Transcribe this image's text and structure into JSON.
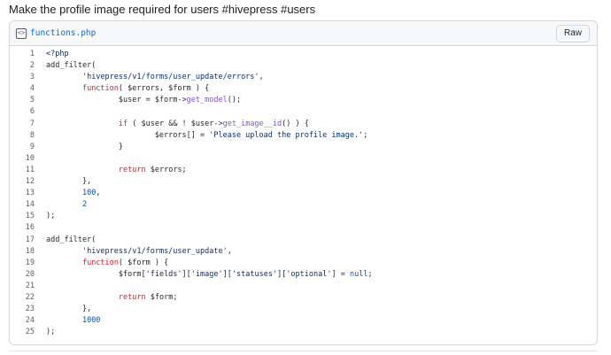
{
  "post": {
    "title": "Make the profile image required for users #hivepress #users"
  },
  "gist": {
    "file_name": "functions.php",
    "raw_label": "Raw",
    "file_icon": "code-file-icon",
    "lines": [
      {
        "n": "1",
        "tokens": [
          {
            "t": "<?php",
            "c": "s"
          }
        ]
      },
      {
        "n": "2",
        "tokens": [
          {
            "t": "add_filter(",
            "c": "v"
          }
        ]
      },
      {
        "n": "3",
        "tokens": [
          {
            "t": "        ",
            "c": "v"
          },
          {
            "t": "'hivepress/v1/forms/user_update/errors'",
            "c": "s"
          },
          {
            "t": ",",
            "c": "v"
          }
        ]
      },
      {
        "n": "4",
        "tokens": [
          {
            "t": "        ",
            "c": "v"
          },
          {
            "t": "function",
            "c": "k"
          },
          {
            "t": "( $errors, $form ) {",
            "c": "v"
          }
        ]
      },
      {
        "n": "5",
        "tokens": [
          {
            "t": "                $user = $form->",
            "c": "v"
          },
          {
            "t": "get_model",
            "c": "f"
          },
          {
            "t": "();",
            "c": "v"
          }
        ]
      },
      {
        "n": "6",
        "tokens": [
          {
            "t": "",
            "c": "v"
          }
        ]
      },
      {
        "n": "7",
        "tokens": [
          {
            "t": "                ",
            "c": "v"
          },
          {
            "t": "if",
            "c": "k"
          },
          {
            "t": " ( $user && ! $user->",
            "c": "v"
          },
          {
            "t": "get_image__id",
            "c": "f"
          },
          {
            "t": "() ) {",
            "c": "v"
          }
        ]
      },
      {
        "n": "8",
        "tokens": [
          {
            "t": "                        $errors[] = ",
            "c": "v"
          },
          {
            "t": "'Please upload the profile image.'",
            "c": "s"
          },
          {
            "t": ";",
            "c": "v"
          }
        ]
      },
      {
        "n": "9",
        "tokens": [
          {
            "t": "                }",
            "c": "v"
          }
        ]
      },
      {
        "n": "10",
        "tokens": [
          {
            "t": "",
            "c": "v"
          }
        ]
      },
      {
        "n": "11",
        "tokens": [
          {
            "t": "                ",
            "c": "v"
          },
          {
            "t": "return",
            "c": "k"
          },
          {
            "t": " $errors;",
            "c": "v"
          }
        ]
      },
      {
        "n": "12",
        "tokens": [
          {
            "t": "        },",
            "c": "v"
          }
        ]
      },
      {
        "n": "13",
        "tokens": [
          {
            "t": "        ",
            "c": "v"
          },
          {
            "t": "100",
            "c": "n"
          },
          {
            "t": ",",
            "c": "v"
          }
        ]
      },
      {
        "n": "14",
        "tokens": [
          {
            "t": "        ",
            "c": "v"
          },
          {
            "t": "2",
            "c": "n"
          }
        ]
      },
      {
        "n": "15",
        "tokens": [
          {
            "t": ");",
            "c": "v"
          }
        ]
      },
      {
        "n": "16",
        "tokens": [
          {
            "t": "",
            "c": "v"
          }
        ]
      },
      {
        "n": "17",
        "tokens": [
          {
            "t": "add_filter(",
            "c": "v"
          }
        ]
      },
      {
        "n": "18",
        "tokens": [
          {
            "t": "        ",
            "c": "v"
          },
          {
            "t": "'hivepress/v1/forms/user_update'",
            "c": "s"
          },
          {
            "t": ",",
            "c": "v"
          }
        ]
      },
      {
        "n": "19",
        "tokens": [
          {
            "t": "        ",
            "c": "v"
          },
          {
            "t": "function",
            "c": "k"
          },
          {
            "t": "( $form ) {",
            "c": "v"
          }
        ]
      },
      {
        "n": "20",
        "tokens": [
          {
            "t": "                $form[",
            "c": "v"
          },
          {
            "t": "'fields'",
            "c": "s"
          },
          {
            "t": "][",
            "c": "v"
          },
          {
            "t": "'image'",
            "c": "s"
          },
          {
            "t": "][",
            "c": "v"
          },
          {
            "t": "'statuses'",
            "c": "s"
          },
          {
            "t": "][",
            "c": "v"
          },
          {
            "t": "'optional'",
            "c": "s"
          },
          {
            "t": "] = ",
            "c": "v"
          },
          {
            "t": "null",
            "c": "n"
          },
          {
            "t": ";",
            "c": "v"
          }
        ]
      },
      {
        "n": "21",
        "tokens": [
          {
            "t": "",
            "c": "v"
          }
        ]
      },
      {
        "n": "22",
        "tokens": [
          {
            "t": "                ",
            "c": "v"
          },
          {
            "t": "return",
            "c": "k"
          },
          {
            "t": " $form;",
            "c": "v"
          }
        ]
      },
      {
        "n": "23",
        "tokens": [
          {
            "t": "        },",
            "c": "v"
          }
        ]
      },
      {
        "n": "24",
        "tokens": [
          {
            "t": "        ",
            "c": "v"
          },
          {
            "t": "1000",
            "c": "n"
          }
        ]
      },
      {
        "n": "25",
        "tokens": [
          {
            "t": ");",
            "c": "v"
          }
        ]
      }
    ]
  }
}
